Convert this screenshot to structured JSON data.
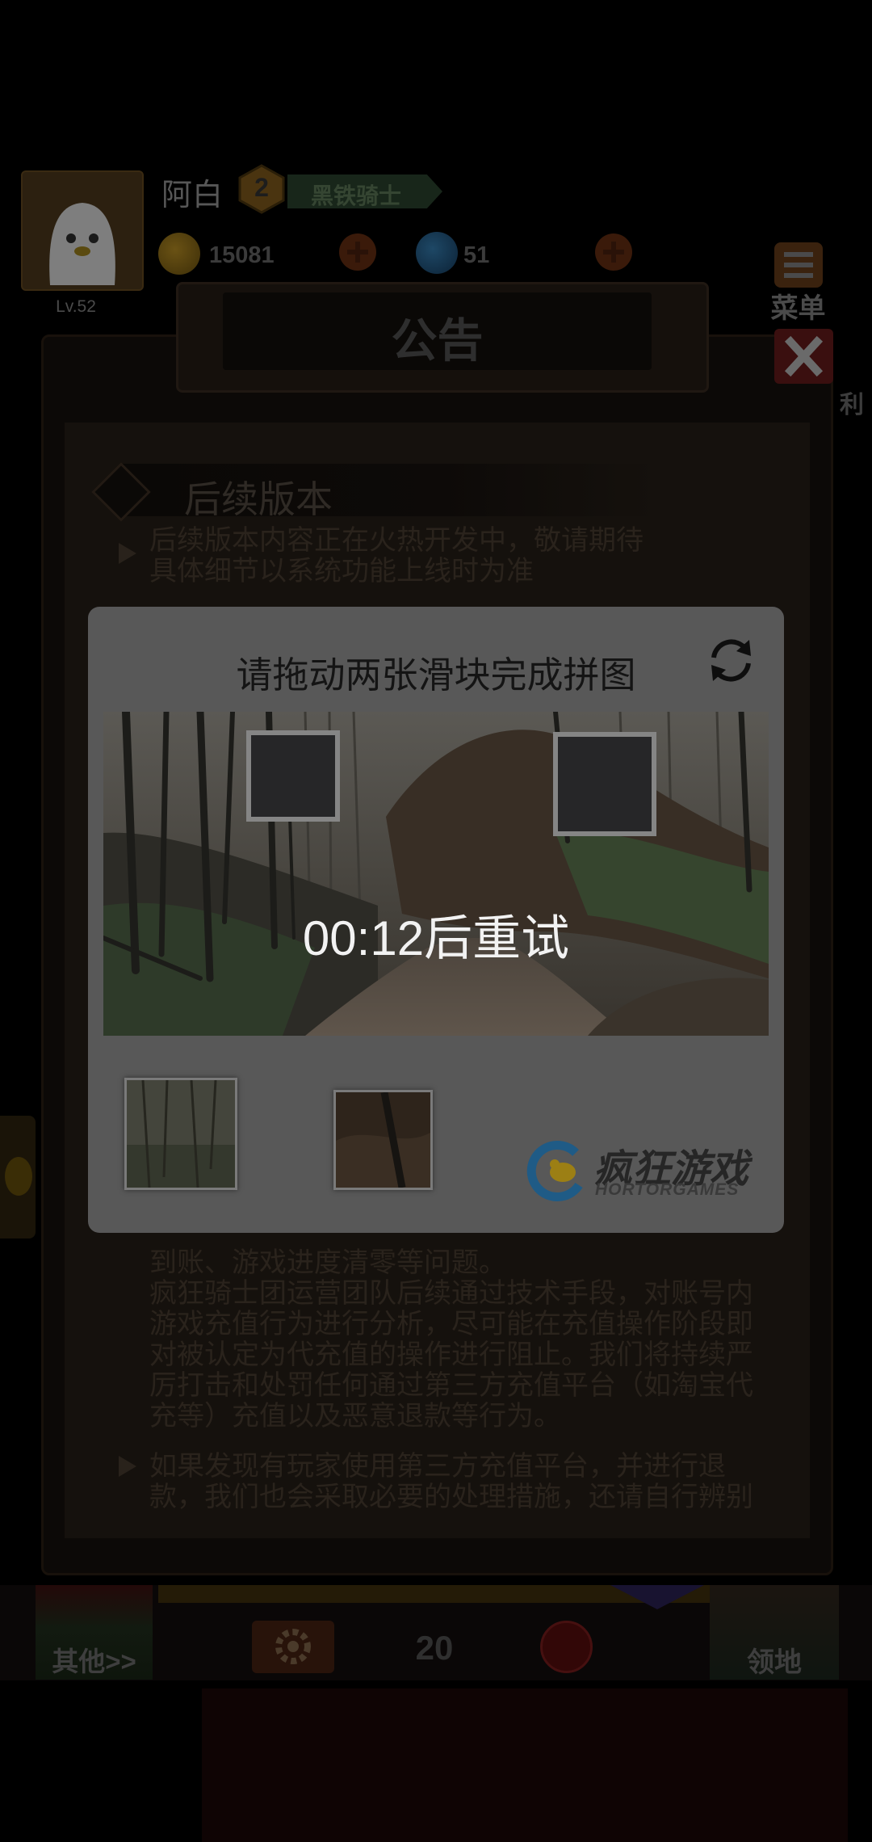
{
  "player": {
    "name": "阿白",
    "level": "2",
    "rank_title": "黑铁骑士",
    "lv": "Lv.52",
    "coins": "15081",
    "gems": "51"
  },
  "top_menu": {
    "menu_label": "菜单",
    "side_label": "利"
  },
  "notice": {
    "title": "公告",
    "section_title": "后续版本",
    "bullet1": [
      "后续版本内容正在火热开发中，敬请期待",
      "具体细节以系统功能上线时为准"
    ],
    "para2": [
      "到账、游戏进度清零等问题。",
      "疯狂骑士团运营团队后续通过技术手段，对账号内",
      "游戏充值行为进行分析，尽可能在充值操作阶段即",
      "对被认定为代充值的操作进行阻止。我们将持续严",
      "厉打击和处罚任何通过第三方充值平台（如淘宝代",
      "充等）充值以及恶意退款等行为。"
    ],
    "bullet3": [
      "如果发现有玩家使用第三方充值平台，并进行退",
      "款，我们也会采取必要的处理措施，还请自行辨别"
    ]
  },
  "bottom_bar": {
    "other_label": "其他>>",
    "count": "20",
    "territory_label": "领地"
  },
  "captcha": {
    "title": "请拖动两张滑块完成拼图",
    "retry_text": "00:12后重试",
    "logo_cn": "疯狂游戏",
    "logo_en": "HORTORGAMES"
  },
  "icons": {
    "avatar": "ghost-avatar-icon",
    "level": "hexagon-level-icon",
    "coin": "coin-icon",
    "gem": "gem-icon",
    "plus": "plus-icon",
    "menu": "menu-icon",
    "close": "close-icon",
    "gear": "gear-icon",
    "refresh": "refresh-icon",
    "logo": "hortor-logo-icon"
  },
  "colors": {
    "overlay": "#000000",
    "dialog_bg": "#585858",
    "retry_text": "#f2f2f2",
    "logo_blue": "#1f5b86",
    "logo_yellow": "#9c7f14"
  }
}
